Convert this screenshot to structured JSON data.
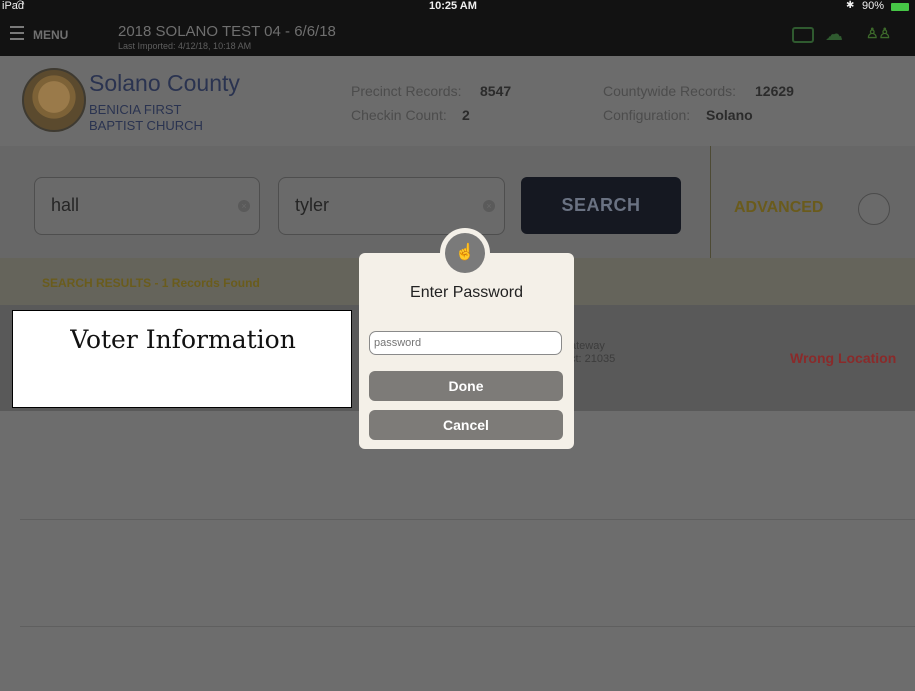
{
  "status_bar": {
    "device": "iPad",
    "time": "10:25 AM",
    "battery": "90%"
  },
  "nav": {
    "menu_label": "MENU",
    "title": "2018 SOLANO TEST 04 - 6/6/18",
    "subtitle": "Last Imported: 4/12/18, 10:18 AM",
    "icons": [
      "printer-icon",
      "cloud-upload-icon",
      "users-icon"
    ]
  },
  "county": {
    "name": "Solano County",
    "location_line1": "BENICIA FIRST",
    "location_line2": "BAPTIST CHURCH",
    "precinct_label": "Precinct Records:",
    "precinct_value": "8547",
    "checkin_label": "Checkin Count:",
    "checkin_value": "2",
    "countywide_label": "Countywide Records:",
    "countywide_value": "12629",
    "config_label": "Configuration:",
    "config_value": "Solano"
  },
  "search": {
    "last_name": "hall",
    "first_name": "tyler",
    "button": "SEARCH",
    "advanced": "ADVANCED"
  },
  "results": {
    "label": "SEARCH RESULTS - 1 Records Found",
    "row": {
      "address_fragment": "ateway",
      "precinct_fragment": "ct: 21035",
      "extra_fragment": ")",
      "status": "Wrong Location"
    }
  },
  "callout": {
    "text": "Voter Information"
  },
  "dialog": {
    "title": "Enter Password",
    "placeholder": "password",
    "done": "Done",
    "cancel": "Cancel"
  },
  "colors": {
    "accent": "#b8a033",
    "wrong": "#d33"
  }
}
